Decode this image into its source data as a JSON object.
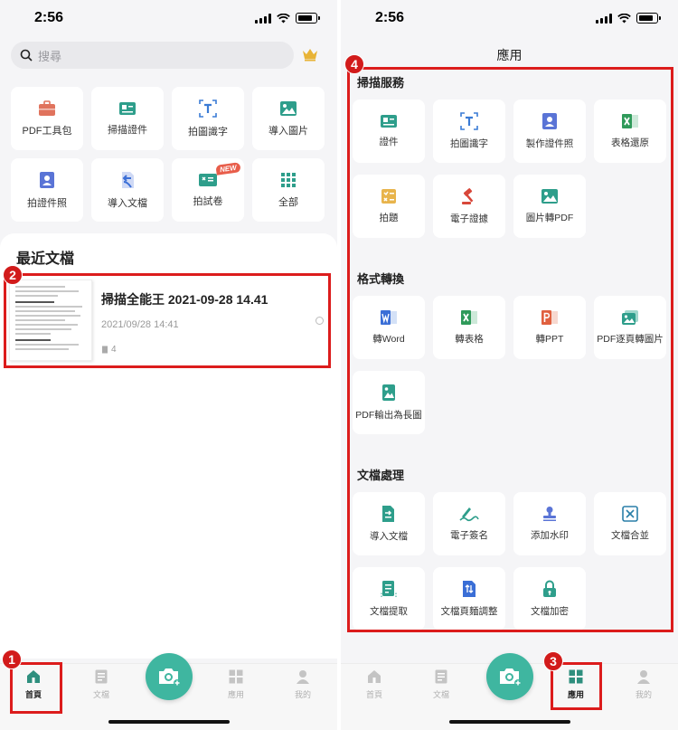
{
  "colors": {
    "accent": "#3fb6a0",
    "annotation": "#dc1c1c",
    "background": "#f5f5f7"
  },
  "left": {
    "status": {
      "time": "2:56"
    },
    "search": {
      "placeholder": "搜尋"
    },
    "tools": [
      {
        "label": "PDF工具包",
        "icon": "briefcase-icon"
      },
      {
        "label": "掃描證件",
        "icon": "id-card-icon"
      },
      {
        "label": "拍圖識字",
        "icon": "text-recognition-icon"
      },
      {
        "label": "導入圖片",
        "icon": "image-icon"
      },
      {
        "label": "拍證件照",
        "icon": "portrait-icon"
      },
      {
        "label": "導入文檔",
        "icon": "import-document-icon"
      },
      {
        "label": "拍試卷",
        "icon": "exam-icon",
        "badge": "NEW"
      },
      {
        "label": "全部",
        "icon": "grid-dots-icon"
      }
    ],
    "recent": {
      "title": "最近文檔",
      "doc": {
        "name": "掃描全能王 2021-09-28 14.41",
        "date": "2021/09/28 14:41",
        "pages": "4"
      }
    },
    "tabs": [
      {
        "label": "首頁",
        "icon": "home-icon"
      },
      {
        "label": "文檔",
        "icon": "document-icon"
      },
      {
        "label": "應用",
        "icon": "apps-grid-icon"
      },
      {
        "label": "我的",
        "icon": "profile-icon"
      }
    ],
    "annotations": [
      "1",
      "2"
    ]
  },
  "right": {
    "status": {
      "time": "2:56"
    },
    "title": "應用",
    "sections": [
      {
        "title": "掃描服務",
        "items": [
          {
            "label": "證件",
            "icon": "id-card-icon"
          },
          {
            "label": "拍圖識字",
            "icon": "text-recognition-icon"
          },
          {
            "label": "製作證件照",
            "icon": "portrait-icon"
          },
          {
            "label": "表格還原",
            "icon": "excel-icon"
          },
          {
            "label": "拍題",
            "icon": "question-icon"
          },
          {
            "label": "電子證據",
            "icon": "gavel-icon"
          },
          {
            "label": "圖片轉PDF",
            "icon": "image-icon"
          }
        ]
      },
      {
        "title": "格式轉換",
        "items": [
          {
            "label": "轉Word",
            "icon": "word-icon"
          },
          {
            "label": "轉表格",
            "icon": "excel-icon"
          },
          {
            "label": "轉PPT",
            "icon": "ppt-icon"
          },
          {
            "label": "PDF逐頁轉圖片",
            "icon": "pdf-to-images-icon"
          },
          {
            "label": "PDF輸出為長圖",
            "icon": "long-image-icon"
          }
        ]
      },
      {
        "title": "文檔處理",
        "items": [
          {
            "label": "導入文檔",
            "icon": "import-document-icon"
          },
          {
            "label": "電子簽名",
            "icon": "signature-icon"
          },
          {
            "label": "添加水印",
            "icon": "stamp-icon"
          },
          {
            "label": "文檔合並",
            "icon": "merge-icon"
          },
          {
            "label": "文檔提取",
            "icon": "extract-icon"
          },
          {
            "label": "文檔頁麵調整",
            "icon": "page-adjust-icon"
          },
          {
            "label": "文檔加密",
            "icon": "lock-icon"
          }
        ]
      }
    ],
    "tabs": [
      {
        "label": "首頁",
        "icon": "home-icon"
      },
      {
        "label": "文檔",
        "icon": "document-icon"
      },
      {
        "label": "應用",
        "icon": "apps-grid-icon"
      },
      {
        "label": "我的",
        "icon": "profile-icon"
      }
    ],
    "annotations": [
      "3",
      "4"
    ]
  }
}
